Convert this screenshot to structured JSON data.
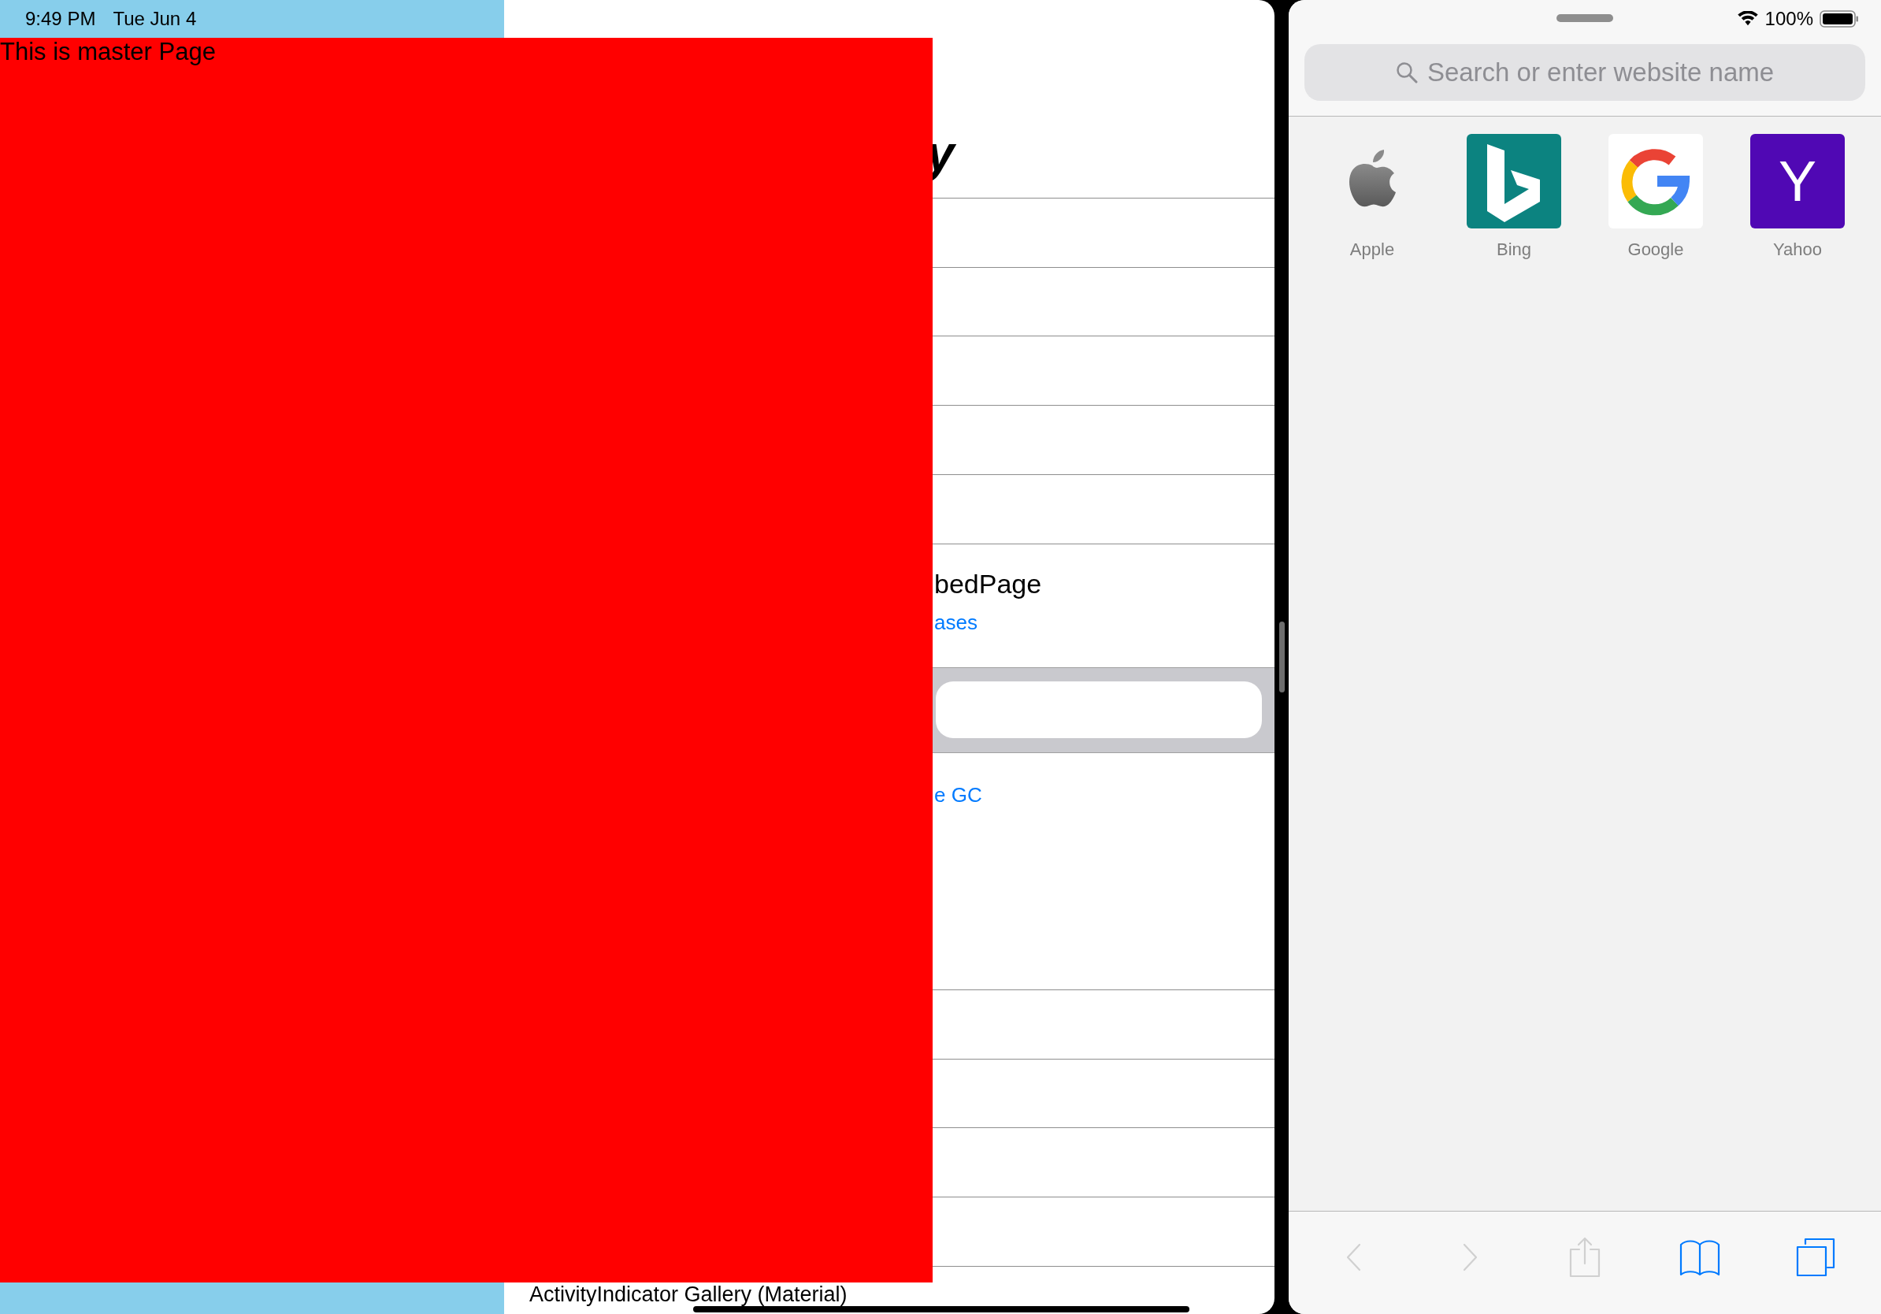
{
  "status_bar": {
    "time": "9:49 PM",
    "date": "Tue Jun 4"
  },
  "master_page": {
    "label": "This is master Page"
  },
  "detail_list": {
    "title_fragment": "y",
    "rows": [
      {
        "kind": "blank"
      },
      {
        "kind": "blank"
      },
      {
        "kind": "blank"
      },
      {
        "kind": "blank"
      },
      {
        "kind": "blank"
      },
      {
        "kind": "two_line",
        "title": "bedPage",
        "subtitle": "ases"
      },
      {
        "kind": "search"
      },
      {
        "kind": "link",
        "text": "e GC"
      },
      {
        "kind": "blank"
      },
      {
        "kind": "blank"
      },
      {
        "kind": "blank"
      },
      {
        "kind": "blank"
      },
      {
        "kind": "text",
        "text": "ActivityIndicator Gallery (Material)"
      }
    ]
  },
  "browser": {
    "battery": "100%",
    "search": {
      "placeholder": "Search or enter website name"
    },
    "favorites": [
      {
        "kind": "apple",
        "label": "Apple"
      },
      {
        "kind": "bing",
        "label": "Bing"
      },
      {
        "kind": "google",
        "label": "Google"
      },
      {
        "kind": "letter",
        "letter": "Y",
        "label": "Yahoo"
      }
    ],
    "toolbar": [
      {
        "kind": "back",
        "disabled": true
      },
      {
        "kind": "forward",
        "disabled": true
      },
      {
        "kind": "share",
        "disabled": true
      },
      {
        "kind": "bookmarks",
        "disabled": false
      },
      {
        "kind": "tabs",
        "disabled": false
      }
    ]
  }
}
